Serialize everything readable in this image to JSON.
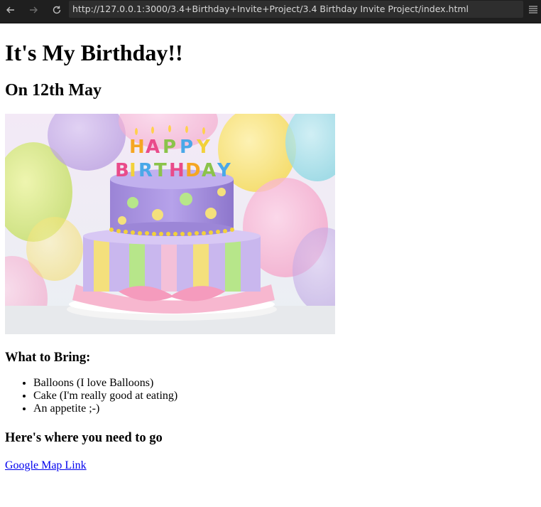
{
  "browser": {
    "url": "http://127.0.0.1:3000/3.4+Birthday+Invite+Project/3.4 Birthday Invite Project/index.html"
  },
  "page": {
    "title": "It's My Birthday!!",
    "date_heading": "On 12th May",
    "image": {
      "cake_text": "HAPPY BIRTHDAY",
      "letter_colors": [
        "#f5a623",
        "#e94b8a",
        "#8bc34a",
        "#4aa8e8",
        "#f2d13b"
      ]
    },
    "bring_heading": "What to Bring:",
    "bring_items": [
      "Balloons (I love Balloons)",
      "Cake (I'm really good at eating)",
      "An appetite ;-)"
    ],
    "where_heading": "Here's where you need to go",
    "map_link_text": "Google Map Link"
  }
}
